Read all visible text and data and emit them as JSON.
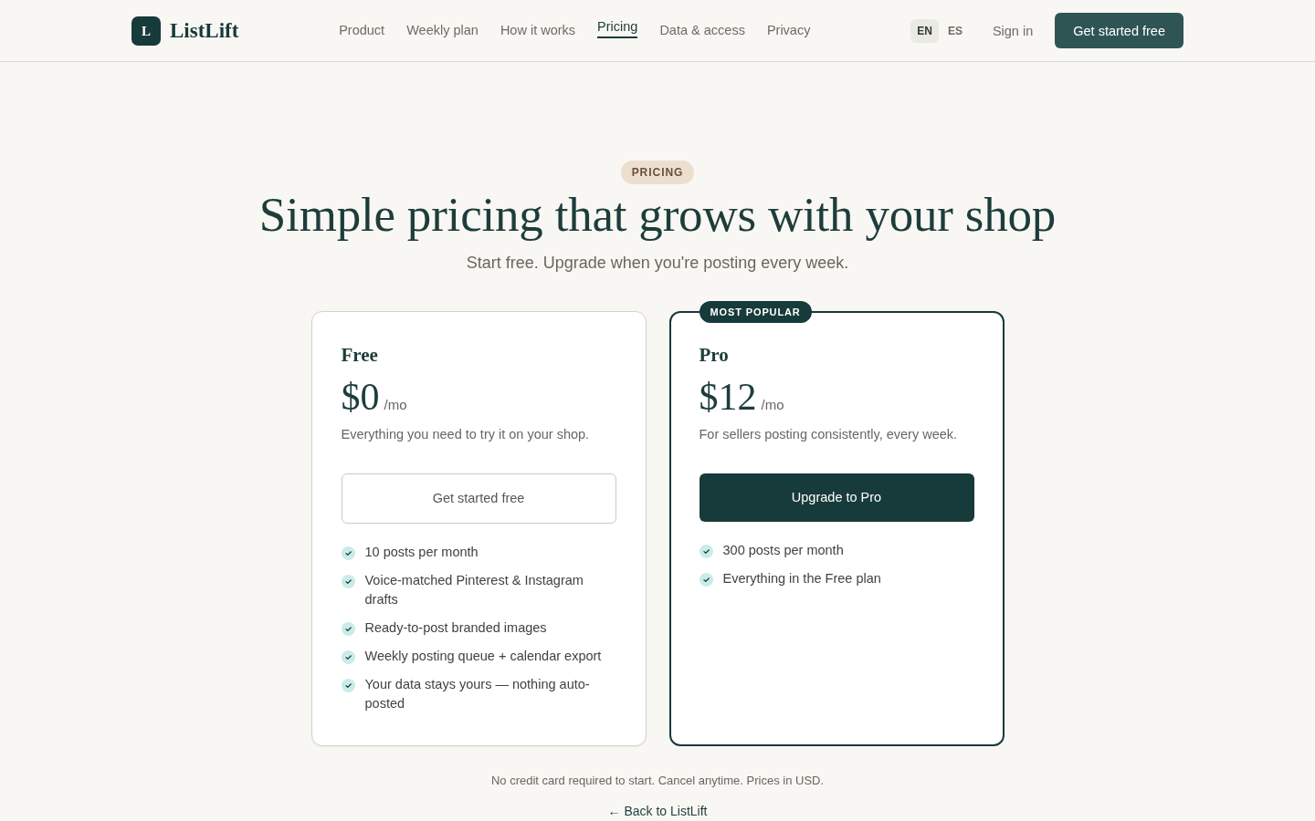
{
  "header": {
    "logo": {
      "mark": "L",
      "name": "ListLift"
    },
    "nav": [
      {
        "label": "Product",
        "selected": false
      },
      {
        "label": "Weekly plan",
        "selected": false
      },
      {
        "label": "How it works",
        "selected": false
      },
      {
        "label": "Pricing",
        "selected": true
      },
      {
        "label": "Data & access",
        "selected": false
      },
      {
        "label": "Privacy",
        "selected": false
      }
    ],
    "languages": [
      {
        "label": "EN",
        "selected": true
      },
      {
        "label": "ES",
        "selected": false
      }
    ],
    "sign_in": "Sign in",
    "cta": "Get started free"
  },
  "hero": {
    "badge": "PRICING",
    "title": "Simple pricing that grows with your shop",
    "subtitle": "Start free. Upgrade when you're posting every week."
  },
  "plans": [
    {
      "name": "Free",
      "highlighted": false,
      "price": "$0",
      "period": "/mo",
      "description": "Everything you need to try it on your shop.",
      "button": {
        "label": "Get started free",
        "kind": "outline"
      },
      "features": [
        "10 posts per month",
        "Voice-matched Pinterest & Instagram drafts",
        "Ready-to-post branded images",
        "Weekly posting queue + calendar export",
        "Your data stays yours — nothing auto-posted"
      ]
    },
    {
      "name": "Pro",
      "highlighted": true,
      "badge": "MOST POPULAR",
      "price": "$12",
      "period": "/mo",
      "description": "For sellers posting consistently, every week.",
      "button": {
        "label": "Upgrade to Pro",
        "kind": "solid"
      },
      "features": [
        "300 posts per month",
        "Everything in the Free plan"
      ]
    }
  ],
  "note": "No credit card required to start. Cancel anytime. Prices in USD.",
  "back_link": "← Back to ListLift"
}
